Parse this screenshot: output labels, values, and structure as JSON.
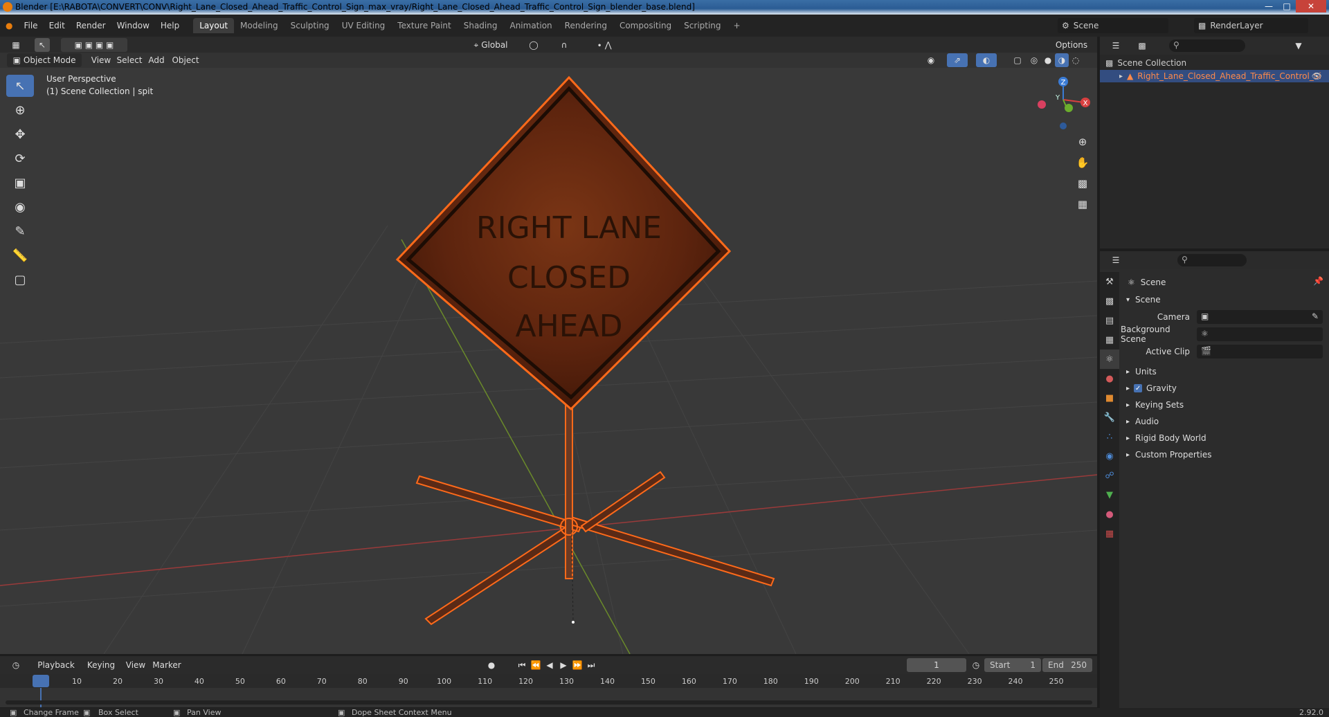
{
  "window": {
    "title": "Blender [E:\\RABOTA\\CONVERT\\CONV\\Right_Lane_Closed_Ahead_Traffic_Control_Sign_max_vray/Right_Lane_Closed_Ahead_Traffic_Control_Sign_blender_base.blend]"
  },
  "menubar": {
    "items": [
      "File",
      "Edit",
      "Render",
      "Window",
      "Help"
    ],
    "workspaces": [
      "Layout",
      "Modeling",
      "Sculpting",
      "UV Editing",
      "Texture Paint",
      "Shading",
      "Animation",
      "Rendering",
      "Compositing",
      "Scripting"
    ],
    "active_workspace": "Layout",
    "add_tab": "+",
    "scene_name": "Scene",
    "render_layer": "RenderLayer"
  },
  "viewport_header": {
    "mode": "Object Mode",
    "menus": [
      "View",
      "Select",
      "Add",
      "Object"
    ],
    "orientation": "Global",
    "options": "Options"
  },
  "viewport": {
    "perspective": "User Perspective",
    "collection_info": "(1) Scene Collection | spit",
    "sign_text": [
      "RIGHT LANE",
      "CLOSED",
      "AHEAD"
    ],
    "gizmo": {
      "x": "X",
      "y": "Y",
      "z": "Z"
    }
  },
  "outliner": {
    "root": "Scene Collection",
    "item": "Right_Lane_Closed_Ahead_Traffic_Control_Si"
  },
  "properties": {
    "context": "Scene",
    "section": "Scene",
    "camera_label": "Camera",
    "background_scene_label": "Background Scene",
    "active_clip_label": "Active Clip",
    "panels": [
      "Units",
      "Gravity",
      "Keying Sets",
      "Audio",
      "Rigid Body World",
      "Custom Properties"
    ],
    "gravity_checked": true
  },
  "timeline": {
    "menus": [
      "Playback",
      "Keying",
      "View",
      "Marker"
    ],
    "current_frame": "1",
    "start_label": "Start",
    "start": "1",
    "end_label": "End",
    "end": "250",
    "ticks": [
      "1",
      "10",
      "20",
      "30",
      "40",
      "50",
      "60",
      "70",
      "80",
      "90",
      "100",
      "110",
      "120",
      "130",
      "140",
      "150",
      "160",
      "170",
      "180",
      "190",
      "200",
      "210",
      "220",
      "230",
      "240",
      "250"
    ]
  },
  "statusbar": {
    "items": [
      "Change Frame",
      "Box Select",
      "Pan View",
      "Dope Sheet Context Menu"
    ],
    "version": "2.92.0"
  },
  "colors": {
    "accent": "#4772b3",
    "selection": "#ff6a1a",
    "sign": "#6b2a12"
  }
}
